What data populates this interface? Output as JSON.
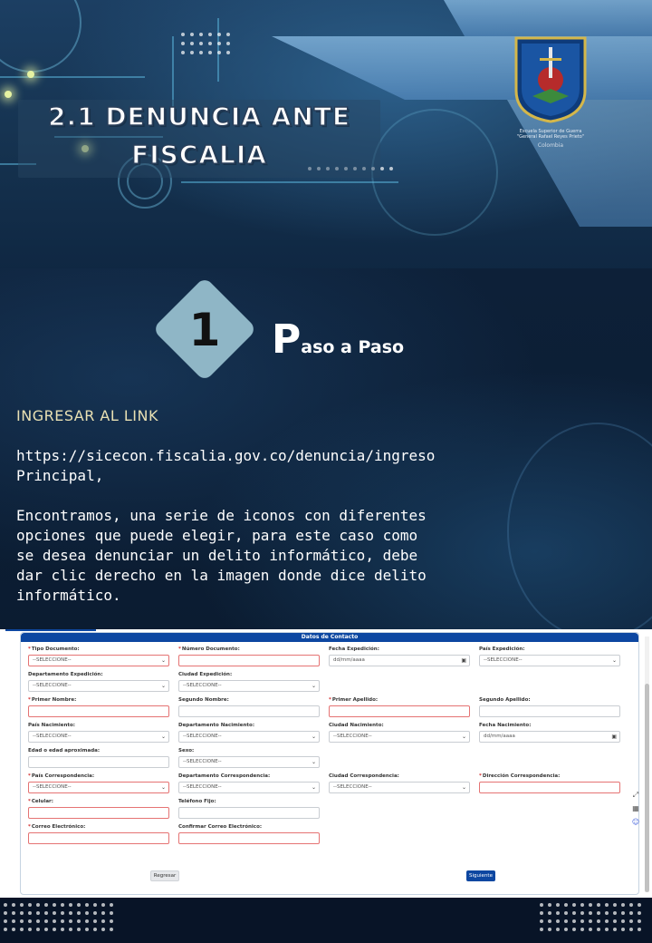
{
  "header": {
    "title_line1": "2.1 DENUNCIA ANTE",
    "title_line2": "FISCALIA",
    "logo_caption_line1": "Escuela Superior de Guerra",
    "logo_caption_line2": "\"General Rafael Reyes Prieto\"",
    "logo_country": "Colombia"
  },
  "step": {
    "number": "1",
    "title_first_letter": "P",
    "title_rest": "aso a Paso"
  },
  "content": {
    "heading": "INGRESAR AL LINK",
    "link": "https://sicecon.fiscalia.gov.co/denuncia/ingreso Principal,",
    "paragraph": "Encontramos, una serie de iconos con diferentes opciones que puede elegir, para este caso como se desea denunciar un delito informático, debe dar clic derecho en la imagen donde dice delito informático."
  },
  "form": {
    "section_title": "Datos de Contacto",
    "fields": [
      {
        "label": "Tipo Documento:",
        "required": true,
        "value": "--SELECCIONE--",
        "type": "select",
        "error": true
      },
      {
        "label": "Número Documento:",
        "required": true,
        "value": "",
        "type": "text",
        "error": true
      },
      {
        "label": "Fecha Expedición:",
        "required": false,
        "value": "dd/mm/aaaa",
        "type": "date",
        "error": false
      },
      {
        "label": "País Expedición:",
        "required": false,
        "value": "--SELECCIONE--",
        "type": "select",
        "error": false
      },
      {
        "label": "Departamento Expedición:",
        "required": false,
        "value": "--SELECCIONE--",
        "type": "select",
        "error": false
      },
      {
        "label": "Ciudad Expedición:",
        "required": false,
        "value": "--SELECCIONE--",
        "type": "select",
        "error": false
      },
      {
        "label": "Primer Nombre:",
        "required": true,
        "value": "",
        "type": "text",
        "error": true
      },
      {
        "label": "Segundo Nombre:",
        "required": false,
        "value": "",
        "type": "text",
        "error": false
      },
      {
        "label": "Primer Apellido:",
        "required": true,
        "value": "",
        "type": "text",
        "error": true
      },
      {
        "label": "Segundo Apellido:",
        "required": false,
        "value": "",
        "type": "text",
        "error": false
      },
      {
        "label": "País Nacimiento:",
        "required": false,
        "value": "--SELECCIONE--",
        "type": "select",
        "error": false
      },
      {
        "label": "Departamento Nacimiento:",
        "required": false,
        "value": "--SELECCIONE--",
        "type": "select",
        "error": false
      },
      {
        "label": "Ciudad Nacimiento:",
        "required": false,
        "value": "--SELECCIONE--",
        "type": "select",
        "error": false
      },
      {
        "label": "Fecha Nacimiento:",
        "required": false,
        "value": "dd/mm/aaaa",
        "type": "date",
        "error": false
      },
      {
        "label": "Edad o edad aproximada:",
        "required": false,
        "value": "",
        "type": "text",
        "error": false
      },
      {
        "label": "Sexo:",
        "required": false,
        "value": "--SELECCIONE--",
        "type": "select",
        "error": false
      },
      {
        "label": "País Correspondencia:",
        "required": true,
        "value": "--SELECCIONE--",
        "type": "select",
        "error": true
      },
      {
        "label": "Departamento Correspondencia:",
        "required": false,
        "value": "--SELECCIONE--",
        "type": "select",
        "error": false
      },
      {
        "label": "Ciudad Correspondencia:",
        "required": false,
        "value": "--SELECCIONE--",
        "type": "select",
        "error": false
      },
      {
        "label": "Dirección Correspondencia:",
        "required": true,
        "value": "",
        "type": "text",
        "error": true
      },
      {
        "label": "Celular:",
        "required": true,
        "value": "",
        "type": "text",
        "error": true
      },
      {
        "label": "Teléfono Fijo:",
        "required": false,
        "value": "",
        "type": "text",
        "error": false
      },
      {
        "label": "Correo Electrónico:",
        "required": true,
        "value": "",
        "type": "text",
        "error": true
      },
      {
        "label": "Confirmar Correo Electrónico:",
        "required": false,
        "value": "",
        "type": "text",
        "error": true
      }
    ],
    "back_label": "Regresar",
    "next_label": "Siguiente"
  }
}
